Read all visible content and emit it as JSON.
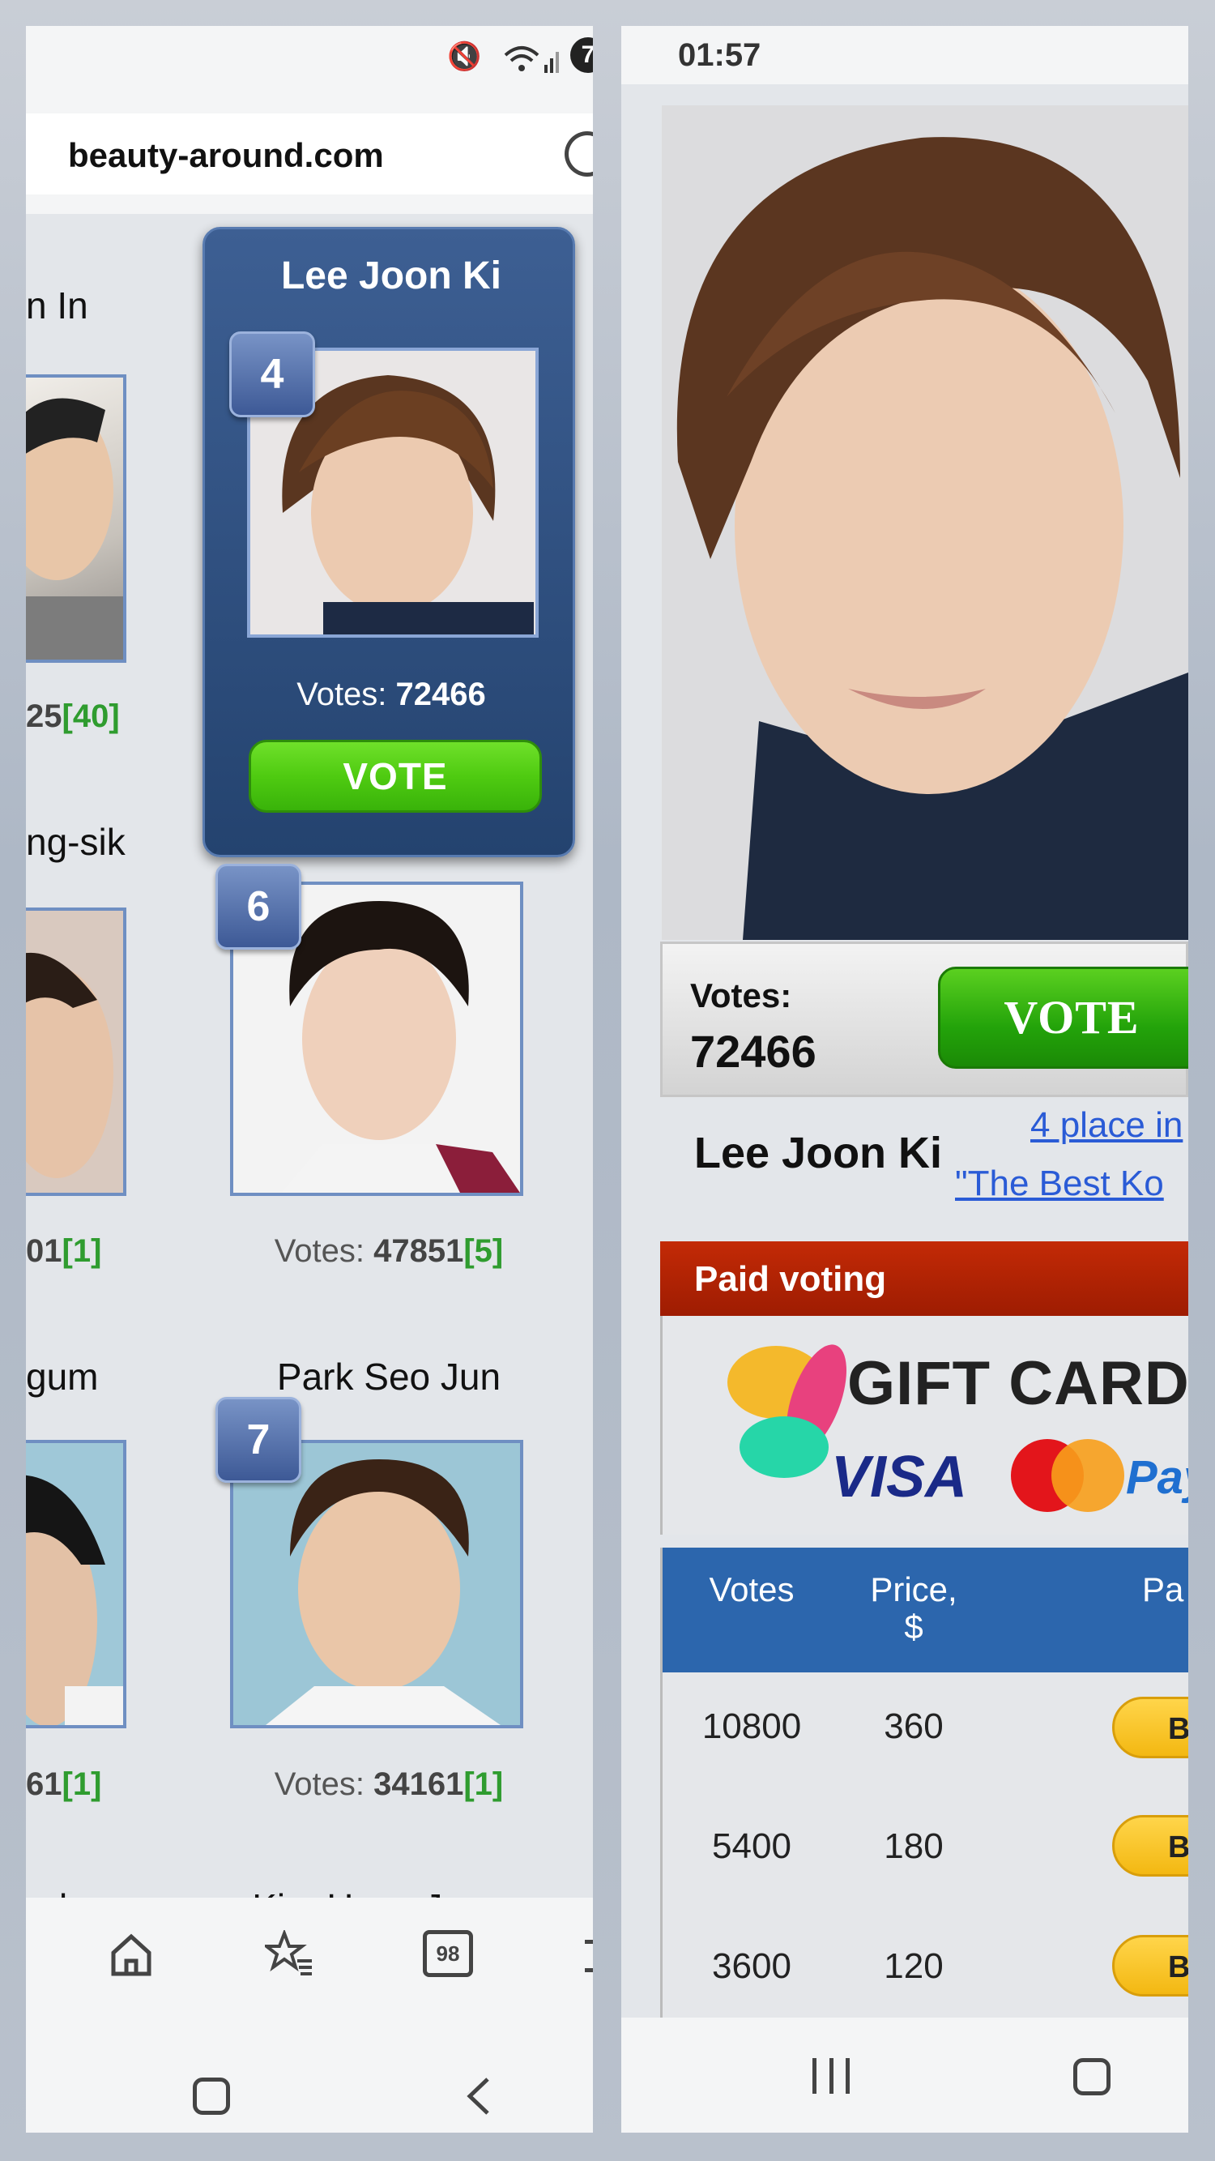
{
  "left": {
    "status": {
      "badge": "7"
    },
    "url": "beauty-around.com",
    "cards": [
      {
        "name_partial": "n In",
        "votes_partial": "25",
        "rank_change": "[40]"
      },
      {
        "name_partial": "ng-sik",
        "votes_partial": "01",
        "rank_change": "[1]"
      },
      {
        "name_partial": "gum",
        "votes_partial": "61",
        "rank_change": "[1]"
      },
      {
        "name_partial": "n-ho"
      }
    ],
    "featured": {
      "name": "Lee Joon Ki",
      "rank": "4",
      "votes_label": "Votes:",
      "votes": "72466",
      "vote_button": "VOTE"
    },
    "card6": {
      "rank": "6",
      "votes_label": "Votes:",
      "votes": "47851",
      "rank_change": "[5]"
    },
    "card7": {
      "name": "Park Seo Jun",
      "rank": "7",
      "votes_label": "Votes:",
      "votes": "34161",
      "rank_change": "[1]"
    },
    "card_next": {
      "name": "Kim Hyun Joong"
    },
    "navbar": {
      "tab_count": "98"
    }
  },
  "right": {
    "status": {
      "time": "01:57"
    },
    "votes_label": "Votes:",
    "votes": "72466",
    "vote_button": "VOTE",
    "name": "Lee Joon Ki",
    "place_link_1": "4 place in",
    "place_link_2": "\"The Best Ko",
    "paid_voting": "Paid voting",
    "gift_cards": "GIFT CARDS",
    "visa": "VISA",
    "paypal": "PayPal",
    "table": {
      "headers": [
        "Votes",
        "Price,",
        "$",
        "Pa"
      ],
      "rows": [
        {
          "votes": "10800",
          "price": "360",
          "buy": "Buy"
        },
        {
          "votes": "5400",
          "price": "180",
          "buy": "Buy"
        },
        {
          "votes": "3600",
          "price": "120",
          "buy": "Buy"
        }
      ]
    }
  },
  "colors": {
    "accent_blue": "#2c66ad",
    "vote_green": "#4fcb11",
    "paid_red": "#b02404",
    "buy_yellow": "#ffd54a"
  }
}
